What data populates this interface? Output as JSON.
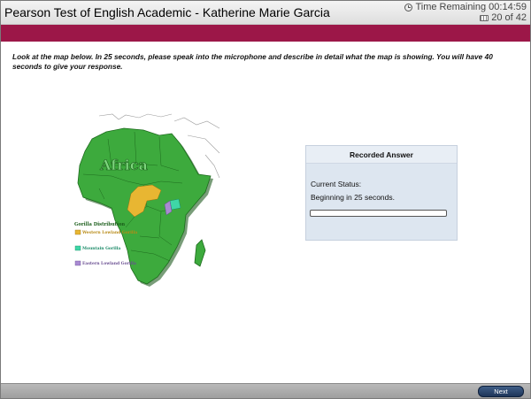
{
  "header": {
    "title": "Pearson Test of English Academic - Katherine Marie Garcia",
    "time_remaining": "Time Remaining 00:14:59",
    "question_counter": "20 of 42"
  },
  "instruction": "Look at the map below. In 25 seconds, please speak into the microphone and describe in detail what the map is showing. You will have 40 seconds to give your response.",
  "map": {
    "title": "Africa",
    "legend_title": "Gorilla Distribution",
    "legend": [
      {
        "label": "Western Lowland Gorilla",
        "color": "#e8b632"
      },
      {
        "label": "Mountain Gorilla",
        "color": "#3fd6a6"
      },
      {
        "label": "Eastern Lowland Gorilla",
        "color": "#a98ad2"
      }
    ],
    "land_color": "#3daa3d"
  },
  "recorder": {
    "heading": "Recorded Answer",
    "status_label": "Current Status:",
    "status_value": "Beginning in 25 seconds.",
    "progress": 0
  },
  "footer": {
    "next_label": "Next"
  },
  "colors": {
    "band": "#9c1748",
    "answer_panel": "#dde6f0",
    "next_button": "#2a4670"
  }
}
